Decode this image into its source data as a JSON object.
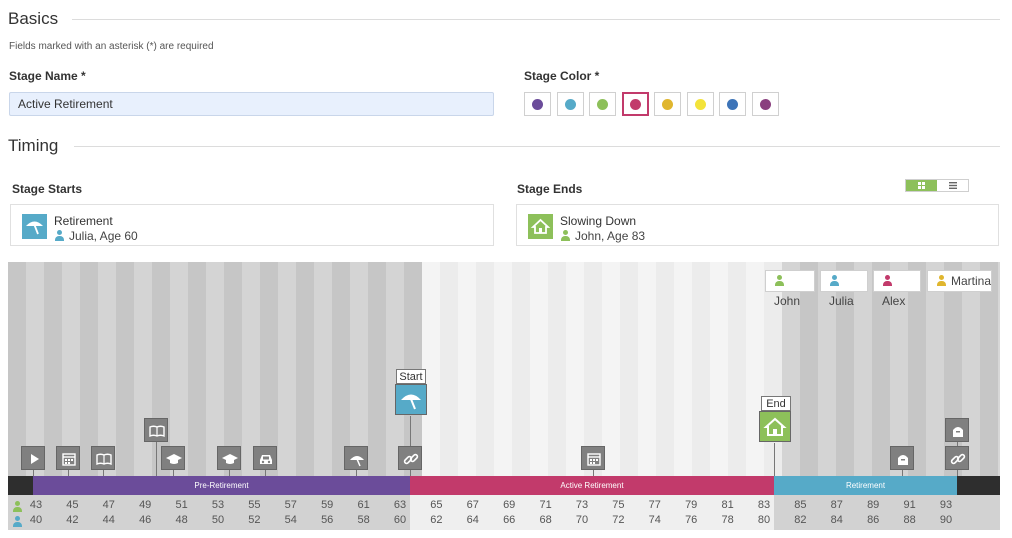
{
  "basics": {
    "title": "Basics",
    "hint": "Fields marked with an asterisk (*) are required",
    "stage_name_label": "Stage Name *",
    "stage_name_value": "Active Retirement",
    "stage_color_label": "Stage Color *",
    "colors": [
      "#6b4c9a",
      "#56aac8",
      "#8dc05a",
      "#c23a6b",
      "#e0b62e",
      "#f3e33a",
      "#3d74b8",
      "#8a3f7e"
    ],
    "selected_color_index": 3
  },
  "timing": {
    "title": "Timing",
    "starts_label": "Stage Starts",
    "ends_label": "Stage Ends",
    "start_event": {
      "title": "Retirement",
      "person": "Julia, Age 60",
      "icon": "umbrella-icon",
      "color": "#56aac8",
      "person_color": "#56aac8"
    },
    "end_event": {
      "title": "Slowing Down",
      "person": "John, Age 83",
      "icon": "home-icon",
      "color": "#8dc05a",
      "person_color": "#8dc05a"
    },
    "view_toggle": {
      "grid_icon": "grid-view-icon",
      "list_icon": "list-view-icon",
      "active": "grid"
    }
  },
  "timeline": {
    "people": [
      {
        "name": "John",
        "color": "#8dc05a"
      },
      {
        "name": "Julia",
        "color": "#56aac8"
      },
      {
        "name": "Alex",
        "color": "#c23a6b"
      },
      {
        "name": "Martina",
        "color": "#e0b62e"
      }
    ],
    "stages": [
      {
        "label": "Pre-Retirement",
        "color": "#6b4c9a"
      },
      {
        "label": "Active Retirement",
        "color": "#c23a6b"
      },
      {
        "label": "Retirement",
        "color": "#56aac8"
      }
    ],
    "start_label": "Start",
    "end_label": "End",
    "john_ages": [
      "43",
      "45",
      "47",
      "49",
      "51",
      "53",
      "55",
      "57",
      "59",
      "61",
      "63",
      "65",
      "67",
      "69",
      "71",
      "73",
      "75",
      "77",
      "79",
      "81",
      "83",
      "85",
      "87",
      "89",
      "91",
      "93"
    ],
    "julia_ages": [
      "40",
      "42",
      "44",
      "46",
      "48",
      "50",
      "52",
      "54",
      "56",
      "58",
      "60",
      "62",
      "64",
      "66",
      "68",
      "70",
      "72",
      "74",
      "76",
      "78",
      "80",
      "82",
      "84",
      "86",
      "88",
      "90"
    ],
    "events": [
      {
        "icon": "play-icon"
      },
      {
        "icon": "calendar-icon"
      },
      {
        "icon": "book-icon"
      },
      {
        "icon": "book-icon"
      },
      {
        "icon": "graduation-cap-icon"
      },
      {
        "icon": "graduation-cap-icon"
      },
      {
        "icon": "car-icon"
      },
      {
        "icon": "umbrella-icon"
      },
      {
        "icon": "link-icon"
      },
      {
        "icon": "calendar-icon"
      },
      {
        "icon": "tombstone-icon"
      },
      {
        "icon": "tombstone-icon"
      },
      {
        "icon": "link-icon"
      }
    ]
  }
}
